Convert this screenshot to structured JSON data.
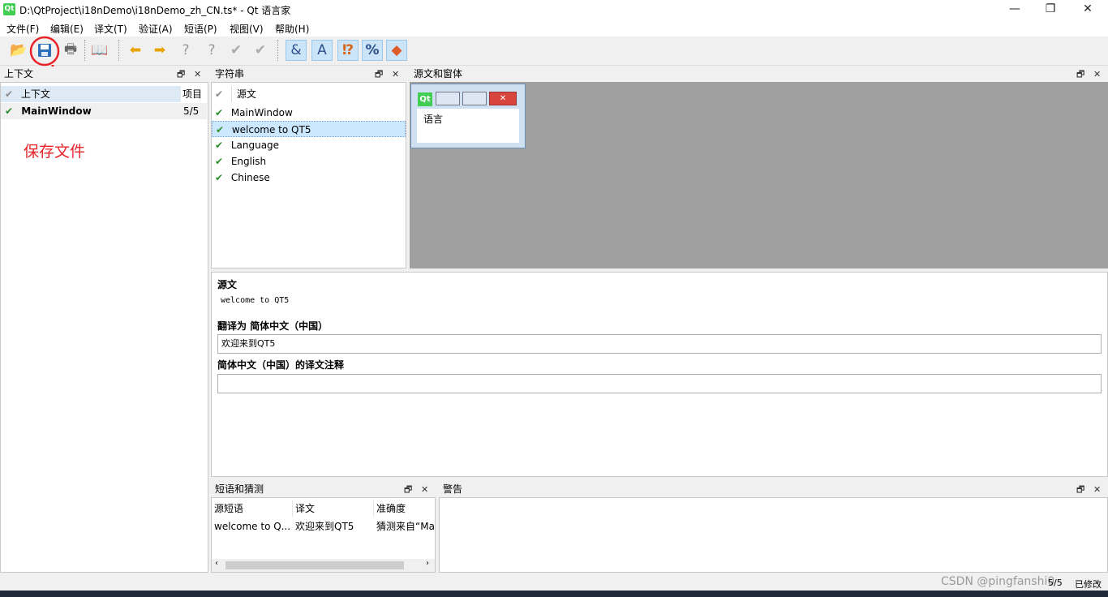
{
  "window": {
    "title": "D:\\QtProject\\i18nDemo\\i18nDemo_zh_CN.ts* - Qt 语言家",
    "icon": "Qt",
    "minimize": "—",
    "maximize": "❐",
    "close": "✕"
  },
  "menu": [
    "文件(F)",
    "编辑(E)",
    "译文(T)",
    "验证(A)",
    "短语(P)",
    "视图(V)",
    "帮助(H)"
  ],
  "toolbar": {
    "icons": [
      "open-folder-icon",
      "save-icon",
      "print-icon",
      "phrasebook-icon",
      "prev-icon",
      "next-icon",
      "prev-unfinished-icon",
      "next-unfinished-icon",
      "done-icon",
      "done-next-icon",
      "accelerators-icon",
      "ending-punctuation-icon",
      "phrase-match-icon",
      "place-marker-icon",
      "surrounding-whitespace-icon"
    ]
  },
  "context_panel": {
    "title": "上下文",
    "columns": [
      "上下文",
      "项目"
    ],
    "rows": [
      {
        "name": "MainWindow",
        "items": "5/5"
      }
    ]
  },
  "strings_panel": {
    "title": "字符串",
    "header": "源文",
    "rows": [
      "MainWindow",
      "welcome to QT5",
      "Language",
      "English",
      "Chinese"
    ],
    "selected": "welcome to QT5"
  },
  "form_panel": {
    "title": "源文和窗体",
    "preview_icon": "Qt",
    "preview_label": "语言"
  },
  "editor": {
    "source_heading": "源文",
    "source_text": "welcome to QT5",
    "translate_heading": "翻译为 简体中文（中国）",
    "translation_value": "欢迎来到QT5",
    "comment_heading": "简体中文（中国）的译文注释",
    "comment_value": ""
  },
  "phrases_panel": {
    "title": "短语和猜测",
    "columns": [
      "源短语",
      "译文",
      "准确度"
    ],
    "rows": [
      {
        "source": "welcome to Q...",
        "translation": "欢迎来到QT5",
        "accuracy": "猜测来自“Ma"
      }
    ]
  },
  "warnings_panel": {
    "title": "警告"
  },
  "annotation": {
    "text": "保存文件",
    "color": "#e8242a"
  },
  "status": {
    "count": "5/5",
    "modified": "已修改",
    "watermark": "CSDN @pingfanshi0"
  },
  "colors": {
    "accent": "#e8242a",
    "check": "#2a8f2a",
    "selection": "#cce8ff"
  }
}
